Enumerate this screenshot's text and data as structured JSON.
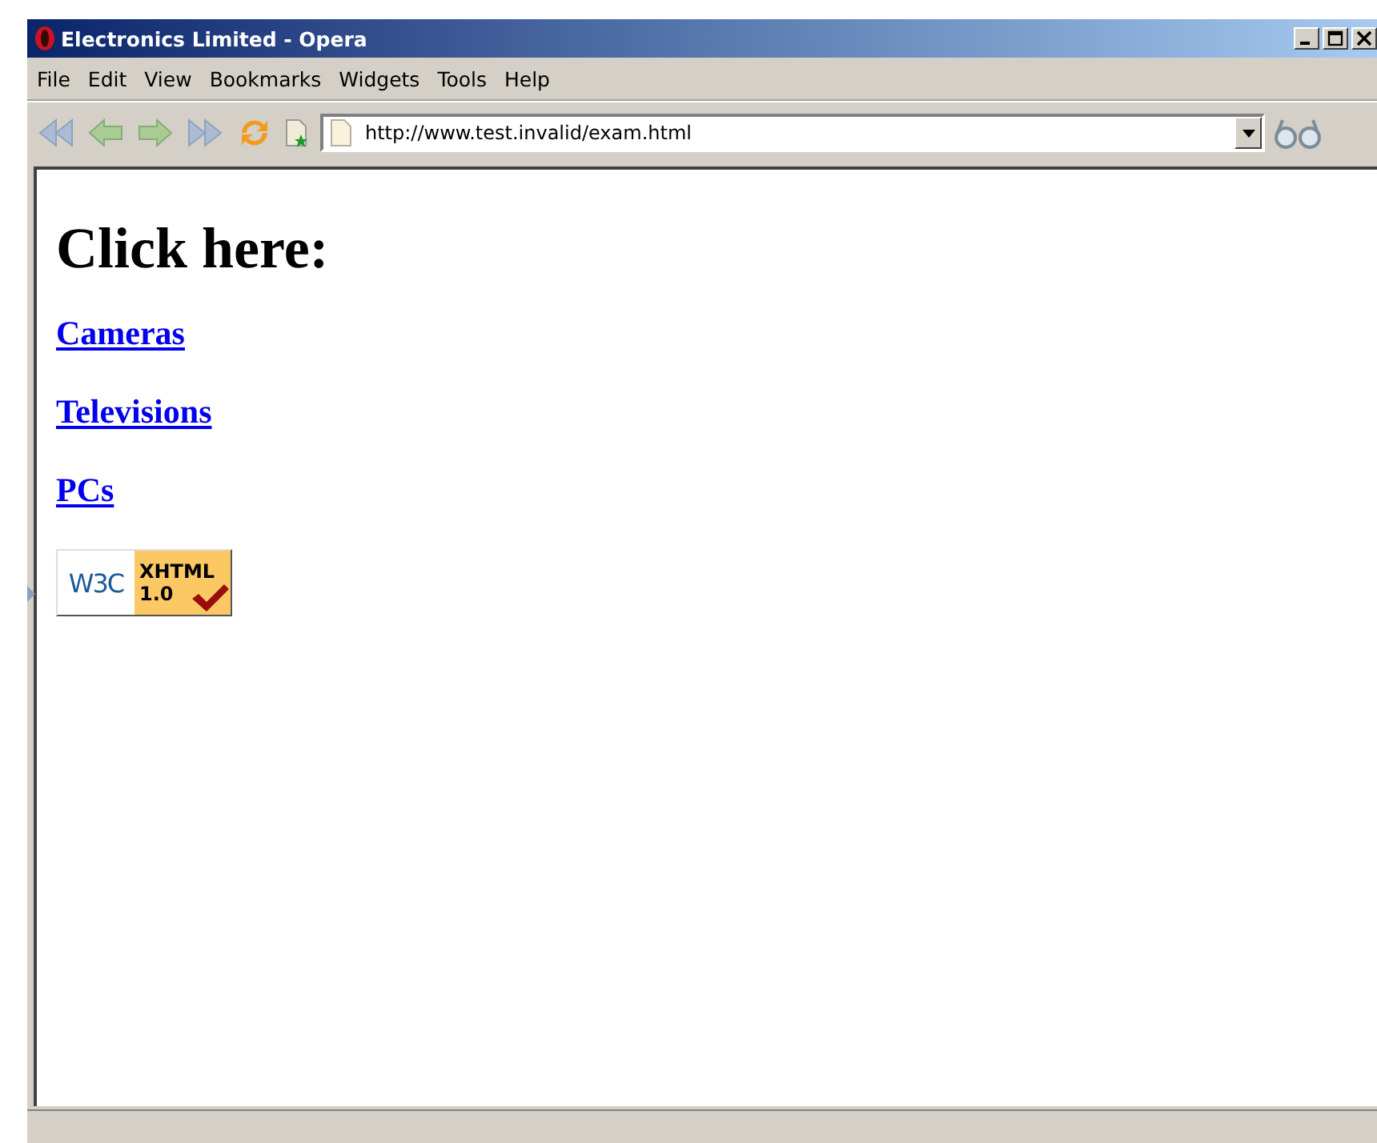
{
  "window": {
    "title": "Electronics Limited - Opera"
  },
  "menu": [
    "File",
    "Edit",
    "View",
    "Bookmarks",
    "Widgets",
    "Tools",
    "Help"
  ],
  "address": {
    "value": "http://www.test.invalid/exam.html"
  },
  "page": {
    "heading": "Click here:",
    "links": [
      "Cameras",
      "Televisions",
      "PCs"
    ],
    "badge": {
      "logo": "W3C",
      "label": "XHTML",
      "version": "1.0"
    }
  }
}
